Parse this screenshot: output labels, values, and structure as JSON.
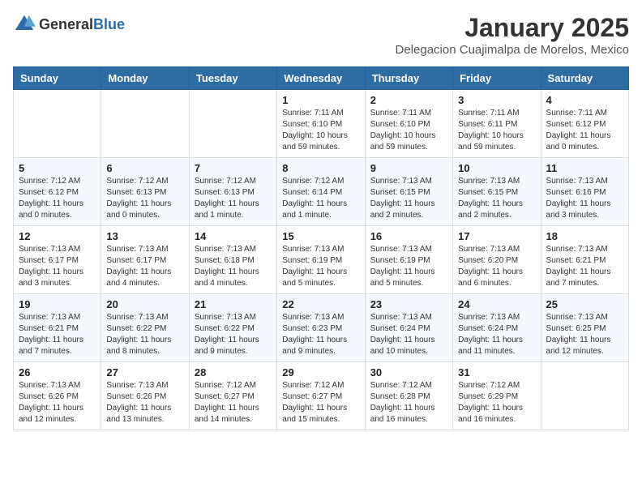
{
  "logo": {
    "general": "General",
    "blue": "Blue"
  },
  "title": "January 2025",
  "subtitle": "Delegacion Cuajimalpa de Morelos, Mexico",
  "weekdays": [
    "Sunday",
    "Monday",
    "Tuesday",
    "Wednesday",
    "Thursday",
    "Friday",
    "Saturday"
  ],
  "weeks": [
    [
      {
        "day": "",
        "sunrise": "",
        "sunset": "",
        "daylight": ""
      },
      {
        "day": "",
        "sunrise": "",
        "sunset": "",
        "daylight": ""
      },
      {
        "day": "",
        "sunrise": "",
        "sunset": "",
        "daylight": ""
      },
      {
        "day": "1",
        "sunrise": "7:11 AM",
        "sunset": "6:10 PM",
        "daylight": "10 hours and 59 minutes."
      },
      {
        "day": "2",
        "sunrise": "7:11 AM",
        "sunset": "6:10 PM",
        "daylight": "10 hours and 59 minutes."
      },
      {
        "day": "3",
        "sunrise": "7:11 AM",
        "sunset": "6:11 PM",
        "daylight": "10 hours and 59 minutes."
      },
      {
        "day": "4",
        "sunrise": "7:11 AM",
        "sunset": "6:12 PM",
        "daylight": "11 hours and 0 minutes."
      }
    ],
    [
      {
        "day": "5",
        "sunrise": "7:12 AM",
        "sunset": "6:12 PM",
        "daylight": "11 hours and 0 minutes."
      },
      {
        "day": "6",
        "sunrise": "7:12 AM",
        "sunset": "6:13 PM",
        "daylight": "11 hours and 0 minutes."
      },
      {
        "day": "7",
        "sunrise": "7:12 AM",
        "sunset": "6:13 PM",
        "daylight": "11 hours and 1 minute."
      },
      {
        "day": "8",
        "sunrise": "7:12 AM",
        "sunset": "6:14 PM",
        "daylight": "11 hours and 1 minute."
      },
      {
        "day": "9",
        "sunrise": "7:13 AM",
        "sunset": "6:15 PM",
        "daylight": "11 hours and 2 minutes."
      },
      {
        "day": "10",
        "sunrise": "7:13 AM",
        "sunset": "6:15 PM",
        "daylight": "11 hours and 2 minutes."
      },
      {
        "day": "11",
        "sunrise": "7:13 AM",
        "sunset": "6:16 PM",
        "daylight": "11 hours and 3 minutes."
      }
    ],
    [
      {
        "day": "12",
        "sunrise": "7:13 AM",
        "sunset": "6:17 PM",
        "daylight": "11 hours and 3 minutes."
      },
      {
        "day": "13",
        "sunrise": "7:13 AM",
        "sunset": "6:17 PM",
        "daylight": "11 hours and 4 minutes."
      },
      {
        "day": "14",
        "sunrise": "7:13 AM",
        "sunset": "6:18 PM",
        "daylight": "11 hours and 4 minutes."
      },
      {
        "day": "15",
        "sunrise": "7:13 AM",
        "sunset": "6:19 PM",
        "daylight": "11 hours and 5 minutes."
      },
      {
        "day": "16",
        "sunrise": "7:13 AM",
        "sunset": "6:19 PM",
        "daylight": "11 hours and 5 minutes."
      },
      {
        "day": "17",
        "sunrise": "7:13 AM",
        "sunset": "6:20 PM",
        "daylight": "11 hours and 6 minutes."
      },
      {
        "day": "18",
        "sunrise": "7:13 AM",
        "sunset": "6:21 PM",
        "daylight": "11 hours and 7 minutes."
      }
    ],
    [
      {
        "day": "19",
        "sunrise": "7:13 AM",
        "sunset": "6:21 PM",
        "daylight": "11 hours and 7 minutes."
      },
      {
        "day": "20",
        "sunrise": "7:13 AM",
        "sunset": "6:22 PM",
        "daylight": "11 hours and 8 minutes."
      },
      {
        "day": "21",
        "sunrise": "7:13 AM",
        "sunset": "6:22 PM",
        "daylight": "11 hours and 9 minutes."
      },
      {
        "day": "22",
        "sunrise": "7:13 AM",
        "sunset": "6:23 PM",
        "daylight": "11 hours and 9 minutes."
      },
      {
        "day": "23",
        "sunrise": "7:13 AM",
        "sunset": "6:24 PM",
        "daylight": "11 hours and 10 minutes."
      },
      {
        "day": "24",
        "sunrise": "7:13 AM",
        "sunset": "6:24 PM",
        "daylight": "11 hours and 11 minutes."
      },
      {
        "day": "25",
        "sunrise": "7:13 AM",
        "sunset": "6:25 PM",
        "daylight": "11 hours and 12 minutes."
      }
    ],
    [
      {
        "day": "26",
        "sunrise": "7:13 AM",
        "sunset": "6:26 PM",
        "daylight": "11 hours and 12 minutes."
      },
      {
        "day": "27",
        "sunrise": "7:13 AM",
        "sunset": "6:26 PM",
        "daylight": "11 hours and 13 minutes."
      },
      {
        "day": "28",
        "sunrise": "7:12 AM",
        "sunset": "6:27 PM",
        "daylight": "11 hours and 14 minutes."
      },
      {
        "day": "29",
        "sunrise": "7:12 AM",
        "sunset": "6:27 PM",
        "daylight": "11 hours and 15 minutes."
      },
      {
        "day": "30",
        "sunrise": "7:12 AM",
        "sunset": "6:28 PM",
        "daylight": "11 hours and 16 minutes."
      },
      {
        "day": "31",
        "sunrise": "7:12 AM",
        "sunset": "6:29 PM",
        "daylight": "11 hours and 16 minutes."
      },
      {
        "day": "",
        "sunrise": "",
        "sunset": "",
        "daylight": ""
      }
    ]
  ]
}
